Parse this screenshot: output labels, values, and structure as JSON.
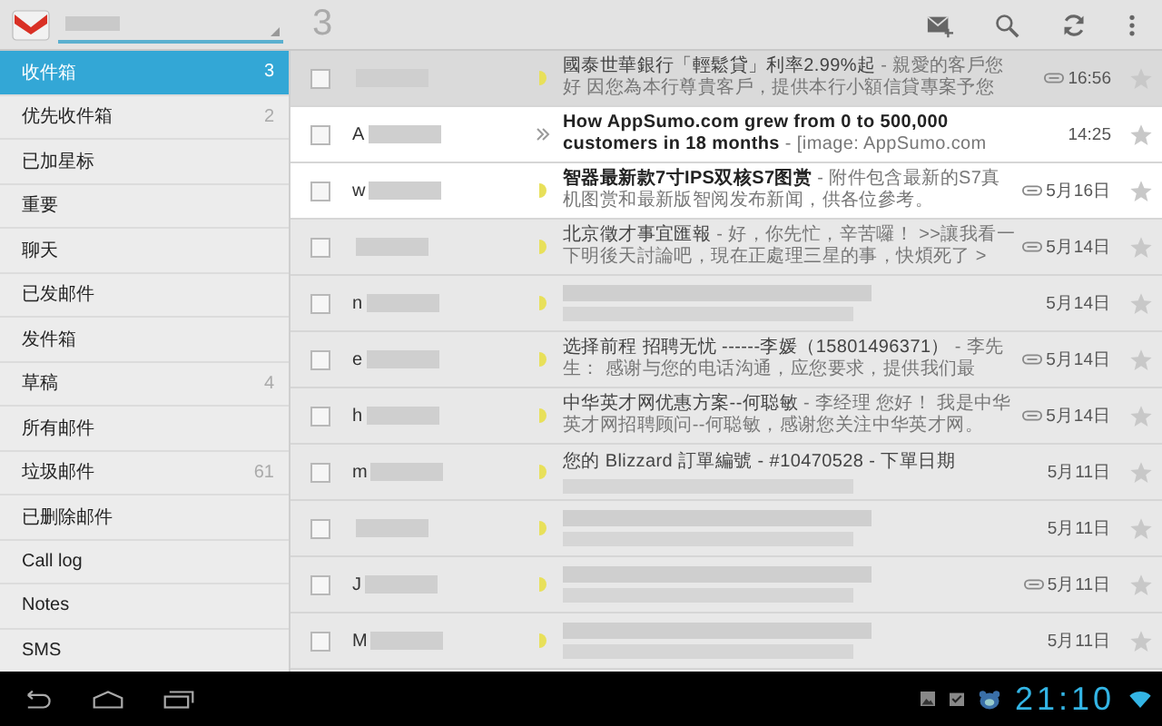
{
  "top_bar": {
    "unread_count": "3"
  },
  "folders": [
    {
      "label": "收件箱",
      "count": "3",
      "selected": true
    },
    {
      "label": "优先收件箱",
      "count": "2",
      "selected": false
    },
    {
      "label": "已加星标",
      "selected": false
    },
    {
      "label": "重要",
      "selected": false
    },
    {
      "label": "聊天",
      "selected": false
    },
    {
      "label": "已发邮件",
      "selected": false
    },
    {
      "label": "发件箱",
      "selected": false
    },
    {
      "label": "草稿",
      "count": "4",
      "selected": false
    },
    {
      "label": "所有邮件",
      "selected": false
    },
    {
      "label": "垃圾邮件",
      "count": "61",
      "selected": false
    },
    {
      "label": "已删除邮件",
      "selected": false
    },
    {
      "label": "Call log",
      "selected": false
    },
    {
      "label": "Notes",
      "selected": false
    },
    {
      "label": "SMS",
      "selected": false
    }
  ],
  "messages": [
    {
      "selected": true,
      "unread": false,
      "important": true,
      "title": "國泰世華銀行「輕鬆貸」利率2.99%起",
      "snippet": " - 親愛的客戶您好 因您為本行尊貴客戶，提供本行小額信貸專案予您",
      "attachment": true,
      "date": "16:56"
    },
    {
      "sender": "A",
      "selected": false,
      "unread": true,
      "important": false,
      "title": "How AppSumo.com grew from 0 to 500,000 customers in 18 months",
      "snippet": " - [image: AppSumo.com",
      "attachment": false,
      "date": "14:25"
    },
    {
      "sender": "w",
      "selected": false,
      "unread": true,
      "important": true,
      "title": "智器最新款7寸IPS双核S7图赏",
      "snippet": " - 附件包含最新的S7真机图赏和最新版智阅发布新闻，供各位參考。",
      "attachment": true,
      "date": "5月16日"
    },
    {
      "selected": false,
      "unread": false,
      "important": true,
      "title": "北京徵才事宜匯報",
      "snippet": " - 好，你先忙，辛苦囉！ >>讓我看一下明後天討論吧，現在正處理三星的事，快煩死了 >",
      "attachment": true,
      "date": "5月14日"
    },
    {
      "sender": "n",
      "selected": false,
      "unread": false,
      "important": true,
      "attachment": false,
      "date": "5月14日"
    },
    {
      "sender": "e",
      "selected": false,
      "unread": false,
      "important": true,
      "title": "选择前程 招聘无忧 ------李媛（15801496371）",
      "snippet": " - 李先生： 感谢与您的电话沟通，应您要求，提供我们最",
      "attachment": true,
      "date": "5月14日"
    },
    {
      "sender": "h",
      "selected": false,
      "unread": false,
      "important": true,
      "title": "中华英才网优惠方案--何聪敏",
      "snippet": " - 李经理 您好！ 我是中华英才网招聘顾问--何聪敏，感谢您关注中华英才网。",
      "attachment": true,
      "date": "5月14日"
    },
    {
      "sender": "m",
      "selected": false,
      "unread": false,
      "important": true,
      "title": "您的 Blizzard 訂單編號 - #10470528 - 下單日期",
      "attachment": false,
      "date": "5月11日"
    },
    {
      "selected": false,
      "unread": false,
      "important": true,
      "attachment": false,
      "date": "5月11日"
    },
    {
      "sender": "J",
      "selected": false,
      "unread": false,
      "important": true,
      "attachment": true,
      "date": "5月11日"
    },
    {
      "sender": "M",
      "selected": false,
      "unread": false,
      "important": true,
      "attachment": false,
      "date": "5月11日"
    }
  ],
  "status_bar": {
    "time": "21:10"
  }
}
